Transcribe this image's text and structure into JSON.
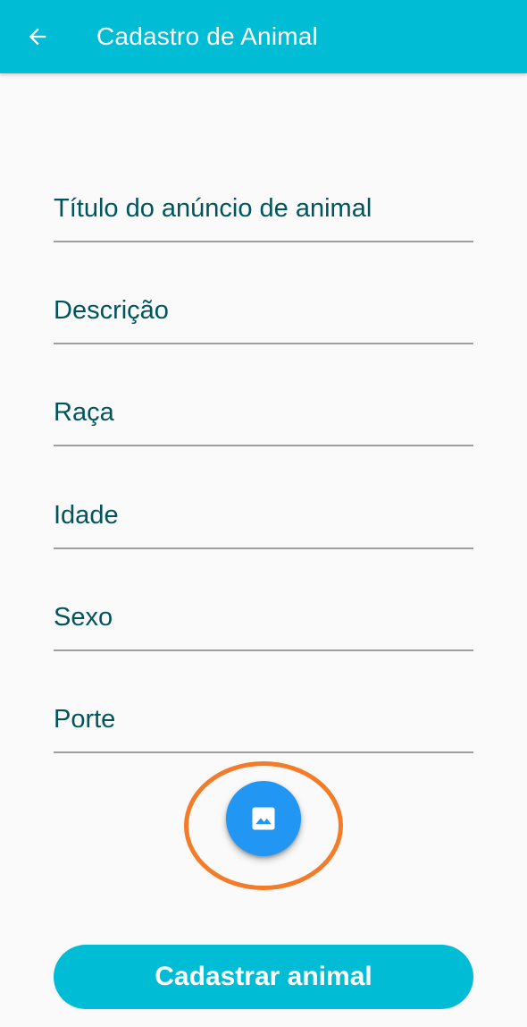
{
  "appbar": {
    "title": "Cadastro de Animal",
    "back_icon": "arrow-back-icon",
    "background_color": "#00bcd4"
  },
  "form": {
    "fields": [
      {
        "placeholder": "Título do anúncio de animal",
        "value": ""
      },
      {
        "placeholder": "Descrição",
        "value": ""
      },
      {
        "placeholder": "Raça",
        "value": ""
      },
      {
        "placeholder": "Idade",
        "value": ""
      },
      {
        "placeholder": "Sexo",
        "value": ""
      },
      {
        "placeholder": "Porte",
        "value": ""
      }
    ]
  },
  "image_button": {
    "icon": "image-icon",
    "color": "#2196f3",
    "highlight_color": "#f47b28"
  },
  "submit": {
    "label": "Cadastrar animal",
    "color": "#00bcd4"
  }
}
